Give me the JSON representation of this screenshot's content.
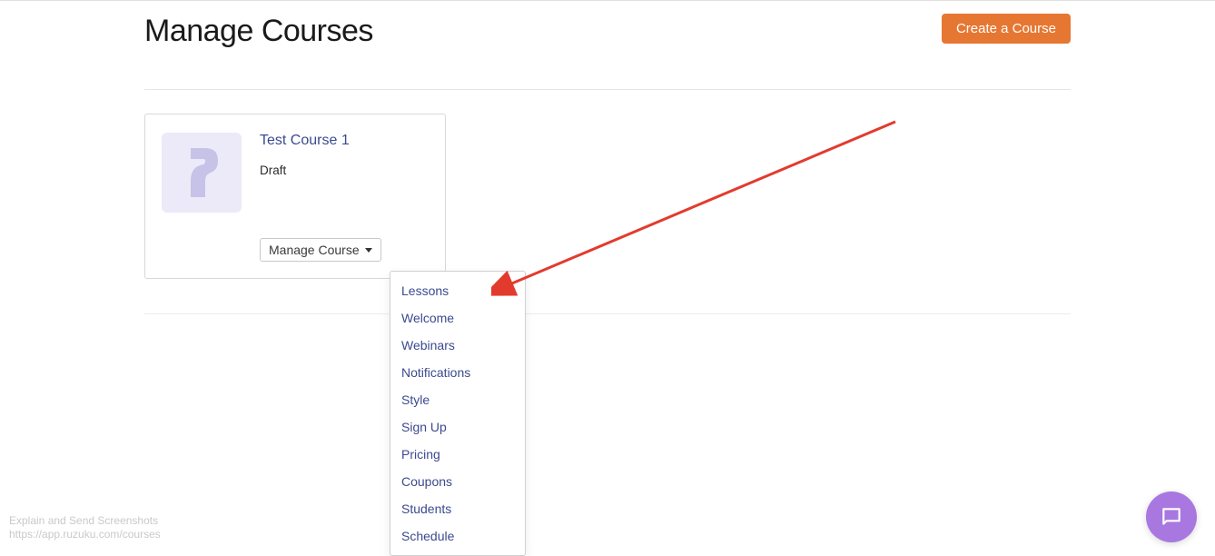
{
  "header": {
    "title": "Manage Courses",
    "create_button": "Create a Course"
  },
  "course": {
    "title": "Test Course 1",
    "status": "Draft",
    "manage_label": "Manage Course"
  },
  "dropdown": {
    "items": [
      "Lessons",
      "Welcome",
      "Webinars",
      "Notifications",
      "Style",
      "Sign Up",
      "Pricing",
      "Coupons",
      "Students",
      "Schedule"
    ]
  },
  "footer": {
    "line1": "Explain and Send Screenshots",
    "line2": "https://app.ruzuku.com/courses"
  }
}
